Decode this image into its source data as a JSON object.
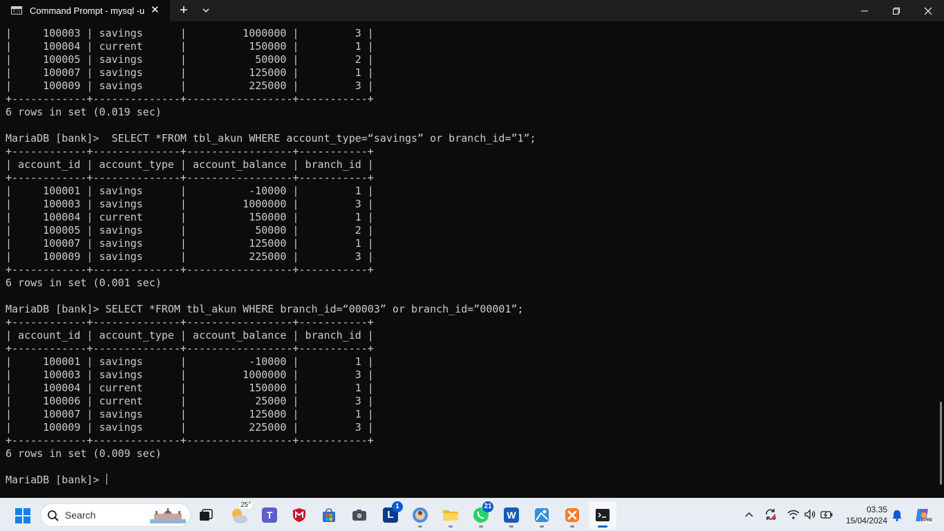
{
  "window": {
    "tab_title": "Command Prompt - mysql  -u",
    "tab_icon_text": "C:\\"
  },
  "terminal": {
    "lines": [
      "|     100003 | savings      |         1000000 |         3 |",
      "|     100004 | current      |          150000 |         1 |",
      "|     100005 | savings      |           50000 |         2 |",
      "|     100007 | savings      |          125000 |         1 |",
      "|     100009 | savings      |          225000 |         3 |",
      "+------------+--------------+-----------------+-----------+",
      "6 rows in set (0.019 sec)",
      "",
      "MariaDB [bank]>  SELECT *FROM tbl_akun WHERE account_type=“savings” or branch_id=”1”;",
      "+------------+--------------+-----------------+-----------+",
      "| account_id | account_type | account_balance | branch_id |",
      "+------------+--------------+-----------------+-----------+",
      "|     100001 | savings      |          -10000 |         1 |",
      "|     100003 | savings      |         1000000 |         3 |",
      "|     100004 | current      |          150000 |         1 |",
      "|     100005 | savings      |           50000 |         2 |",
      "|     100007 | savings      |          125000 |         1 |",
      "|     100009 | savings      |          225000 |         3 |",
      "+------------+--------------+-----------------+-----------+",
      "6 rows in set (0.001 sec)",
      "",
      "MariaDB [bank]> SELECT *FROM tbl_akun WHERE branch_id=“00003” or branch_id=”00001”;",
      "+------------+--------------+-----------------+-----------+",
      "| account_id | account_type | account_balance | branch_id |",
      "+------------+--------------+-----------------+-----------+",
      "|     100001 | savings      |          -10000 |         1 |",
      "|     100003 | savings      |         1000000 |         3 |",
      "|     100004 | current      |          150000 |         1 |",
      "|     100006 | current      |           25000 |         3 |",
      "|     100007 | savings      |          125000 |         1 |",
      "|     100009 | savings      |          225000 |         3 |",
      "+------------+--------------+-----------------+-----------+",
      "6 rows in set (0.009 sec)",
      ""
    ],
    "prompt": "MariaDB [bank]> "
  },
  "taskbar": {
    "search_label": "Search",
    "weather_temp": "25°",
    "apps": [
      {
        "name": "task-view",
        "badge": ""
      },
      {
        "name": "weather-widget",
        "badge": ""
      },
      {
        "name": "teams",
        "badge": ""
      },
      {
        "name": "mcafee",
        "badge": ""
      },
      {
        "name": "microsoft-store",
        "badge": ""
      },
      {
        "name": "camera",
        "badge": ""
      },
      {
        "name": "lark",
        "badge": "1"
      },
      {
        "name": "chrome-profile",
        "badge": ""
      },
      {
        "name": "file-explorer",
        "badge": ""
      },
      {
        "name": "whatsapp",
        "badge": "21"
      },
      {
        "name": "word",
        "badge": ""
      },
      {
        "name": "maps",
        "badge": ""
      },
      {
        "name": "xampp",
        "badge": ""
      },
      {
        "name": "terminal",
        "badge": ""
      }
    ],
    "clock": {
      "time": "03.35",
      "date": "15/04/2024"
    },
    "copilot_badge": "PRE"
  },
  "colors": {
    "terminal_bg": "#0c0c0c",
    "terminal_fg": "#cccccc",
    "titlebar_bg": "#1f1f1f",
    "accent": "#0067c0"
  }
}
